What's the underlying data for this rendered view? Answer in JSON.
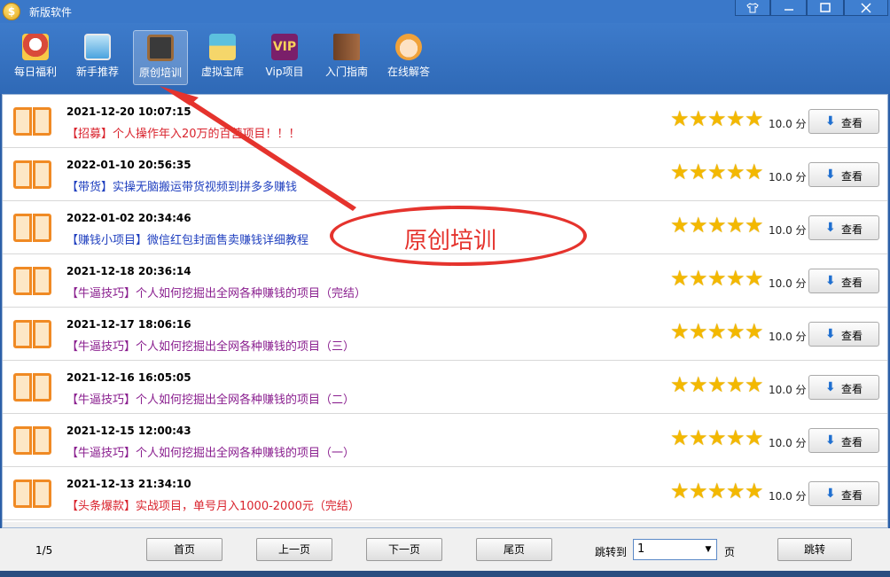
{
  "window": {
    "title": "新版软件",
    "app_icon": "coin-icon",
    "controls": [
      "shirt-icon",
      "minimize-icon",
      "maximize-icon",
      "close-icon"
    ]
  },
  "toolbar": {
    "items": [
      {
        "label": "每日福利",
        "icon": "lucky-cat-icon",
        "color": "#d94a3a"
      },
      {
        "label": "新手推荐",
        "icon": "monitor-icon",
        "color": "#4aa3df"
      },
      {
        "label": "原创培训",
        "icon": "chalkboard-icon",
        "color": "#7a4b2a",
        "active": true
      },
      {
        "label": "虚拟宝库",
        "icon": "building-icon",
        "color": "#3fa9c9"
      },
      {
        "label": "Vip项目",
        "icon": "vip-icon",
        "color": "#7a1f6a",
        "badge": "VIP"
      },
      {
        "label": "入门指南",
        "icon": "guide-book-icon",
        "color": "#8a5a3a"
      },
      {
        "label": "在线解答",
        "icon": "support-agent-icon",
        "color": "#f0a23a"
      }
    ]
  },
  "list": {
    "rows": [
      {
        "date": "2021-12-20 10:07:15",
        "title": "【招募】个人操作年入20万的百营项目！！！",
        "color": "#d9232d",
        "score": "10.0 分",
        "button": "查看"
      },
      {
        "date": "2022-01-10 20:56:35",
        "title": "【带货】实操无脑搬运带货视频到拼多多赚钱",
        "color": "#1f3fbf",
        "score": "10.0 分",
        "button": "查看"
      },
      {
        "date": "2022-01-02 20:34:46",
        "title": "【赚钱小项目】微信红包封面售卖赚钱详细教程",
        "color": "#1f3fbf",
        "score": "10.0 分",
        "button": "查看"
      },
      {
        "date": "2021-12-18 20:36:14",
        "title": "【牛逼技巧】个人如何挖掘出全网各种赚钱的项目（完结）",
        "color": "#8a1f8f",
        "score": "10.0 分",
        "button": "查看"
      },
      {
        "date": "2021-12-17 18:06:16",
        "title": "【牛逼技巧】个人如何挖掘出全网各种赚钱的项目（三）",
        "color": "#8a1f8f",
        "score": "10.0 分",
        "button": "查看"
      },
      {
        "date": "2021-12-16 16:05:05",
        "title": "【牛逼技巧】个人如何挖掘出全网各种赚钱的项目（二）",
        "color": "#8a1f8f",
        "score": "10.0 分",
        "button": "查看"
      },
      {
        "date": "2021-12-15 12:00:43",
        "title": "【牛逼技巧】个人如何挖掘出全网各种赚钱的项目（一）",
        "color": "#8a1f8f",
        "score": "10.0 分",
        "button": "查看"
      },
      {
        "date": "2021-12-13 21:34:10",
        "title": "【头条爆款】实战项目，单号月入1000-2000元（完结）",
        "color": "#d9232d",
        "score": "10.0 分",
        "button": "查看"
      }
    ],
    "rating_stars": 5
  },
  "footer": {
    "page_info": "1/5",
    "first": "首页",
    "prev": "上一页",
    "next": "下一页",
    "last": "尾页",
    "jump_label": "跳转到",
    "jump_value": "1",
    "unit": "页",
    "jump_button": "跳转"
  },
  "annotation": {
    "text": "原创培训",
    "color": "#e5332d"
  }
}
